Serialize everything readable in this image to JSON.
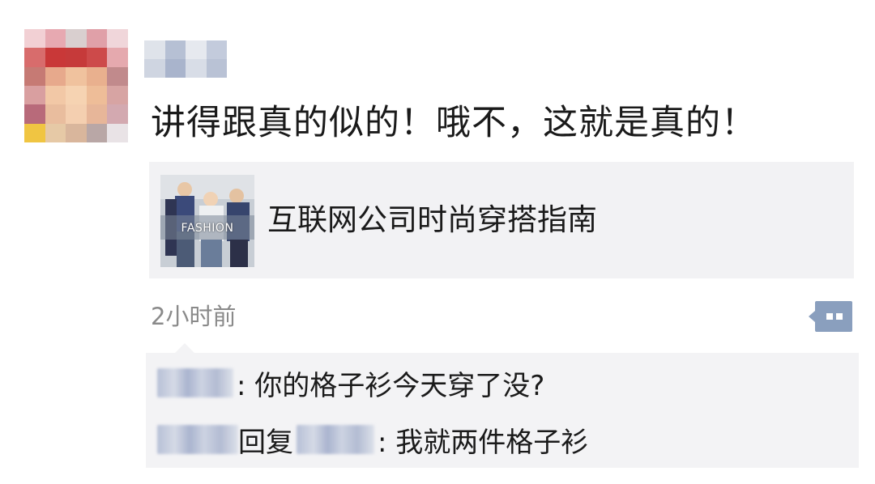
{
  "post": {
    "text": "讲得跟真的似的！哦不，这就是真的！",
    "timestamp": "2小时前"
  },
  "link_card": {
    "title": "互联网公司时尚穿搭指南",
    "thumbnail_caption": "FASHION"
  },
  "comments": [
    {
      "text": ": 你的格子衫今天穿了没?"
    },
    {
      "reply_label": "回复",
      "text": ": 我就两件格子衫"
    }
  ],
  "icons": {
    "comment": "comment-bubble-icon"
  },
  "colors": {
    "comment_icon": "#8a9fbe",
    "card_background": "#f2f2f4",
    "timestamp": "#8a8a8a"
  }
}
